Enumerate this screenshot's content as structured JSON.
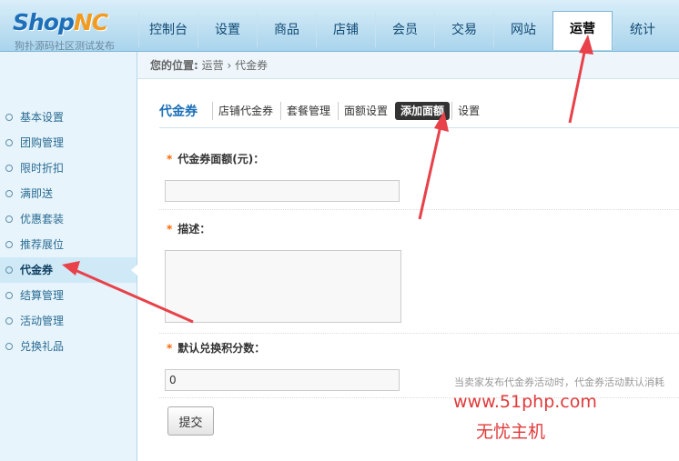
{
  "header": {
    "logo_main": "Shop",
    "logo_accent": "NC",
    "logo_sub": "狗扑源码社区测试发布",
    "nav": [
      "控制台",
      "设置",
      "商品",
      "店铺",
      "会员",
      "交易",
      "网站",
      "运营",
      "统计"
    ],
    "active_nav": "运营"
  },
  "breadcrumb": {
    "label": "您的位置:",
    "path1": "运营",
    "sep": "›",
    "path2": "代金券"
  },
  "sidebar": {
    "items": [
      {
        "label": "基本设置"
      },
      {
        "label": "团购管理"
      },
      {
        "label": "限时折扣"
      },
      {
        "label": "满即送"
      },
      {
        "label": "优惠套装"
      },
      {
        "label": "推荐展位"
      },
      {
        "label": "代金券"
      },
      {
        "label": "结算管理"
      },
      {
        "label": "活动管理"
      },
      {
        "label": "兑换礼品"
      }
    ],
    "active": "代金券"
  },
  "subnav": {
    "title": "代金券",
    "items": [
      "店铺代金券",
      "套餐管理",
      "面额设置",
      "添加面额",
      "设置"
    ],
    "active": "添加面额"
  },
  "form": {
    "req_mark": "*",
    "denomination_label": "代金券面额(元)：",
    "denomination_value": "",
    "description_label": "描述：",
    "points_label": "默认兑换积分数：",
    "points_value": "0",
    "points_hint": "当卖家发布代金券活动时，代金券活动默认消耗",
    "submit_label": "提交"
  },
  "watermark": {
    "url": "www.51php.com",
    "text": "无忧主机"
  },
  "colors": {
    "arrow": "#e8414a",
    "accent": "#1d6fb8",
    "required": "#ff6600"
  }
}
